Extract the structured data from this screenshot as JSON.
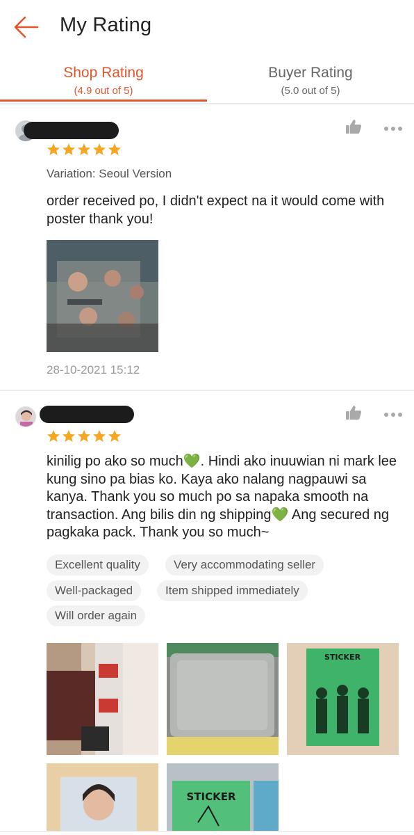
{
  "header": {
    "title": "My Rating",
    "back_icon": "back-arrow-icon",
    "accent_color": "#e2562d"
  },
  "tabs": [
    {
      "label": "Shop Rating",
      "sub": "(4.9 out of 5)",
      "active": true
    },
    {
      "label": "Buyer Rating",
      "sub": "(5.0 out of 5)",
      "active": false
    }
  ],
  "reviews": [
    {
      "rating": 5,
      "variation": "Variation: Seoul Version",
      "text": "order received po, I didn't expect na it would come with poster thank you!",
      "timestamp": "28-10-2021 15:12",
      "like_icon": "thumbs-up-icon",
      "more_icon": "more-dots-icon"
    },
    {
      "rating": 5,
      "text": "kinilig po ako so much💚. Hindi ako inuuwian ni mark lee kung sino pa bias ko. Kaya ako nalang nagpauwi sa kanya. Thank you so much po sa napaka smooth na transaction. Ang bilis din ng shipping💚 Ang secured ng pagkaka pack. Thank you so much~",
      "tags": [
        "Excellent quality",
        "Very accommodating seller",
        "Well-packaged",
        "Item shipped immediately",
        "Will order again"
      ],
      "photo_text": {
        "sticker_1": "STICKER",
        "sticker_2": "STICKER"
      },
      "like_icon": "thumbs-up-icon",
      "more_icon": "more-dots-icon"
    }
  ],
  "star_color": "#f5a623"
}
